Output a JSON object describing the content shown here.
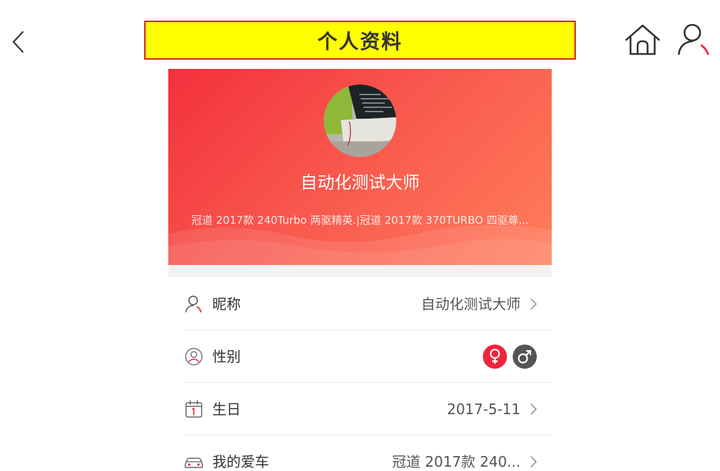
{
  "header": {
    "title": "个人资料"
  },
  "profile": {
    "name": "自动化测试大师",
    "cars": "冠道 2017款 240Turbo 两驱精英.|冠道 2017款 370TURBO 四驱尊..."
  },
  "rows": {
    "nickname": {
      "label": "昵称",
      "value": "自动化测试大师"
    },
    "gender": {
      "label": "性别",
      "selected": "none"
    },
    "birthday": {
      "label": "生日",
      "value": "2017-5-11"
    },
    "car": {
      "label": "我的爱车",
      "value": "冠道 2017款 240..."
    }
  },
  "colors": {
    "accent": "#f0243c",
    "title_bg": "#ffff00",
    "title_border": "#e02020",
    "header_gradient_start": "#f3303c",
    "header_gradient_end": "#ff7e5c",
    "male_badge": "#555555"
  },
  "icons": {
    "back": "chevron-left-icon",
    "home": "home-icon",
    "user": "user-icon",
    "nickname": "person-icon",
    "gender": "gender-icon",
    "birthday": "calendar-icon",
    "car": "car-icon",
    "female": "female-symbol-icon",
    "male": "male-symbol-icon"
  }
}
